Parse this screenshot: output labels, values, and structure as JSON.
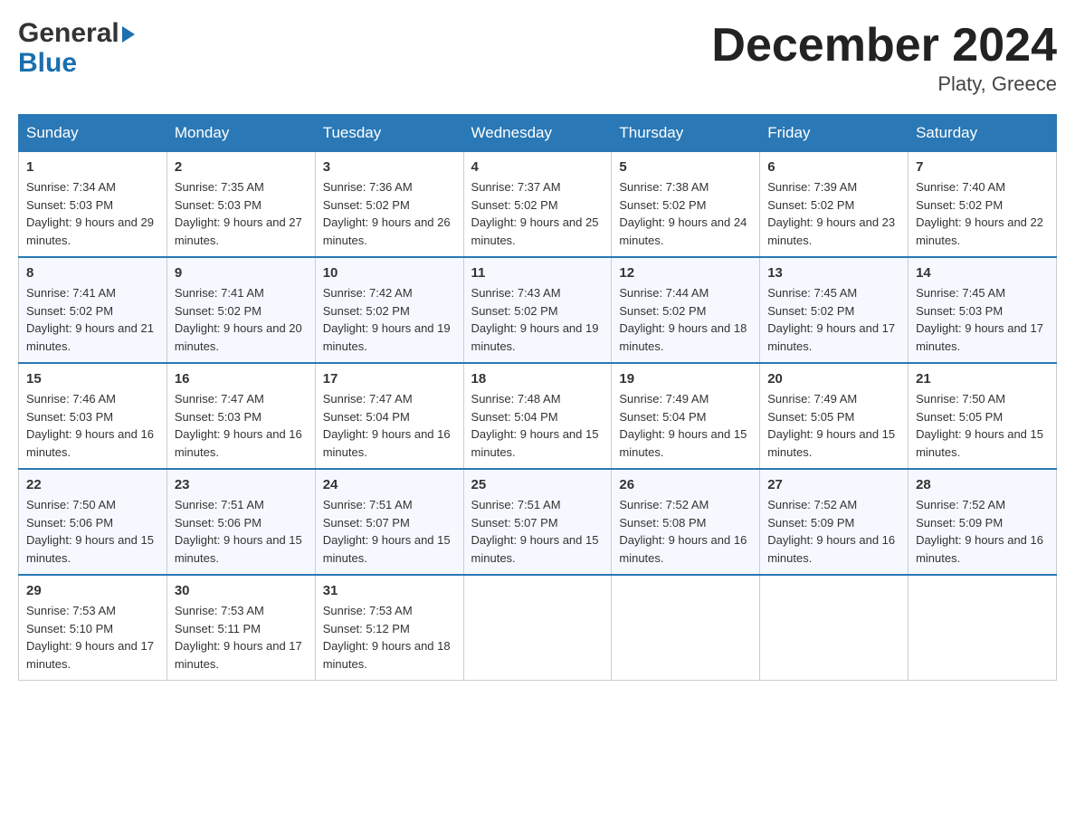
{
  "header": {
    "logo_general": "General",
    "logo_blue": "Blue",
    "month_title": "December 2024",
    "location": "Platy, Greece"
  },
  "days_of_week": [
    "Sunday",
    "Monday",
    "Tuesday",
    "Wednesday",
    "Thursday",
    "Friday",
    "Saturday"
  ],
  "weeks": [
    [
      {
        "day": "1",
        "sunrise": "7:34 AM",
        "sunset": "5:03 PM",
        "daylight": "9 hours and 29 minutes."
      },
      {
        "day": "2",
        "sunrise": "7:35 AM",
        "sunset": "5:03 PM",
        "daylight": "9 hours and 27 minutes."
      },
      {
        "day": "3",
        "sunrise": "7:36 AM",
        "sunset": "5:02 PM",
        "daylight": "9 hours and 26 minutes."
      },
      {
        "day": "4",
        "sunrise": "7:37 AM",
        "sunset": "5:02 PM",
        "daylight": "9 hours and 25 minutes."
      },
      {
        "day": "5",
        "sunrise": "7:38 AM",
        "sunset": "5:02 PM",
        "daylight": "9 hours and 24 minutes."
      },
      {
        "day": "6",
        "sunrise": "7:39 AM",
        "sunset": "5:02 PM",
        "daylight": "9 hours and 23 minutes."
      },
      {
        "day": "7",
        "sunrise": "7:40 AM",
        "sunset": "5:02 PM",
        "daylight": "9 hours and 22 minutes."
      }
    ],
    [
      {
        "day": "8",
        "sunrise": "7:41 AM",
        "sunset": "5:02 PM",
        "daylight": "9 hours and 21 minutes."
      },
      {
        "day": "9",
        "sunrise": "7:41 AM",
        "sunset": "5:02 PM",
        "daylight": "9 hours and 20 minutes."
      },
      {
        "day": "10",
        "sunrise": "7:42 AM",
        "sunset": "5:02 PM",
        "daylight": "9 hours and 19 minutes."
      },
      {
        "day": "11",
        "sunrise": "7:43 AM",
        "sunset": "5:02 PM",
        "daylight": "9 hours and 19 minutes."
      },
      {
        "day": "12",
        "sunrise": "7:44 AM",
        "sunset": "5:02 PM",
        "daylight": "9 hours and 18 minutes."
      },
      {
        "day": "13",
        "sunrise": "7:45 AM",
        "sunset": "5:02 PM",
        "daylight": "9 hours and 17 minutes."
      },
      {
        "day": "14",
        "sunrise": "7:45 AM",
        "sunset": "5:03 PM",
        "daylight": "9 hours and 17 minutes."
      }
    ],
    [
      {
        "day": "15",
        "sunrise": "7:46 AM",
        "sunset": "5:03 PM",
        "daylight": "9 hours and 16 minutes."
      },
      {
        "day": "16",
        "sunrise": "7:47 AM",
        "sunset": "5:03 PM",
        "daylight": "9 hours and 16 minutes."
      },
      {
        "day": "17",
        "sunrise": "7:47 AM",
        "sunset": "5:04 PM",
        "daylight": "9 hours and 16 minutes."
      },
      {
        "day": "18",
        "sunrise": "7:48 AM",
        "sunset": "5:04 PM",
        "daylight": "9 hours and 15 minutes."
      },
      {
        "day": "19",
        "sunrise": "7:49 AM",
        "sunset": "5:04 PM",
        "daylight": "9 hours and 15 minutes."
      },
      {
        "day": "20",
        "sunrise": "7:49 AM",
        "sunset": "5:05 PM",
        "daylight": "9 hours and 15 minutes."
      },
      {
        "day": "21",
        "sunrise": "7:50 AM",
        "sunset": "5:05 PM",
        "daylight": "9 hours and 15 minutes."
      }
    ],
    [
      {
        "day": "22",
        "sunrise": "7:50 AM",
        "sunset": "5:06 PM",
        "daylight": "9 hours and 15 minutes."
      },
      {
        "day": "23",
        "sunrise": "7:51 AM",
        "sunset": "5:06 PM",
        "daylight": "9 hours and 15 minutes."
      },
      {
        "day": "24",
        "sunrise": "7:51 AM",
        "sunset": "5:07 PM",
        "daylight": "9 hours and 15 minutes."
      },
      {
        "day": "25",
        "sunrise": "7:51 AM",
        "sunset": "5:07 PM",
        "daylight": "9 hours and 15 minutes."
      },
      {
        "day": "26",
        "sunrise": "7:52 AM",
        "sunset": "5:08 PM",
        "daylight": "9 hours and 16 minutes."
      },
      {
        "day": "27",
        "sunrise": "7:52 AM",
        "sunset": "5:09 PM",
        "daylight": "9 hours and 16 minutes."
      },
      {
        "day": "28",
        "sunrise": "7:52 AM",
        "sunset": "5:09 PM",
        "daylight": "9 hours and 16 minutes."
      }
    ],
    [
      {
        "day": "29",
        "sunrise": "7:53 AM",
        "sunset": "5:10 PM",
        "daylight": "9 hours and 17 minutes."
      },
      {
        "day": "30",
        "sunrise": "7:53 AM",
        "sunset": "5:11 PM",
        "daylight": "9 hours and 17 minutes."
      },
      {
        "day": "31",
        "sunrise": "7:53 AM",
        "sunset": "5:12 PM",
        "daylight": "9 hours and 18 minutes."
      },
      null,
      null,
      null,
      null
    ]
  ],
  "labels": {
    "sunrise": "Sunrise:",
    "sunset": "Sunset:",
    "daylight": "Daylight:"
  }
}
